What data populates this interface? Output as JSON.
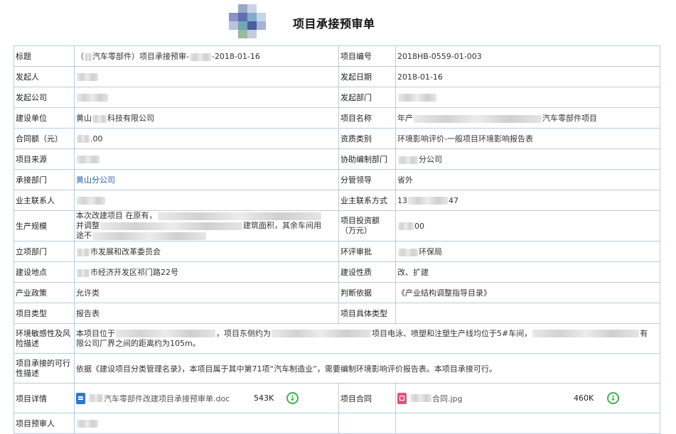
{
  "header": {
    "title": "项目承接预审单"
  },
  "fields": {
    "title_label": "标题",
    "title_prefix": "（",
    "title_middle": "汽车零部件）项目承接预审-",
    "title_suffix": "-2018-01-16",
    "project_no_label": "项目编号",
    "project_no": "2018HB-0559-01-003",
    "initiator_label": "发起人",
    "initiator_prefix": "",
    "init_date_label": "发起日期",
    "init_date": "2018-01-16",
    "init_company_label": "发起公司",
    "init_dept_label": "发起部门",
    "builder_label": "建设单位",
    "builder_prefix": "黄山",
    "builder_suffix": "科技有限公司",
    "project_name_label": "项目名称",
    "project_name_prefix": "年产",
    "project_name_suffix": "汽车零部件项目",
    "contract_amount_label": "合同额（元）",
    "contract_amount_suffix": ".00",
    "qualification_label": "资质类别",
    "qualification": "环境影响评价-一般项目环境影响报告表",
    "source_label": "项目来源",
    "assist_dept_label": "协助编制部门",
    "assist_dept_suffix": "分公司",
    "undertake_dept_label": "承接部门",
    "undertake_dept": "黄山分公司",
    "leader_label": "分管领导",
    "leader": "省外",
    "owner_contact_label": "业主联系人",
    "owner_phone_label": "业主联系方式",
    "owner_phone_prefix": "13",
    "owner_phone_suffix": "47",
    "scale_label": "生产规模",
    "scale_line1": "本次改建项目 在原有，",
    "scale_line2_prefix": "并调整",
    "scale_line2_suffix": "建筑面积，其余车间用",
    "scale_line3": "途不",
    "investment_label": "项目投资额（万元）",
    "investment_suffix": "00",
    "approval_dept_label": "立项部门",
    "approval_dept_suffix": "市发展和改革委员会",
    "eia_approval_label": "环评审批",
    "eia_approval_suffix": "环保局",
    "location_label": "建设地点",
    "location_suffix": "市经济开发区祁门路22号",
    "nature_label": "建设性质",
    "nature": "改、扩建",
    "policy_label": "产业政策",
    "policy": "允许类",
    "basis_label": "判断依据",
    "basis": "《产业结构调整指导目录》",
    "type_label": "项目类型",
    "type": "报告表",
    "specific_type_label": "项目具体类型",
    "specific_type": "",
    "sensitivity_label": "环境敏感性及风险描述",
    "sensitivity_line1_a": "本项目位于",
    "sensitivity_line1_b": "，项目东侧约为",
    "sensitivity_line1_c": "项目电泳、喷塑和注塑生产线均位于5#车间，",
    "sensitivity_line1_d": "有",
    "sensitivity_line2": "限公司厂界之间的距离约为105m。",
    "feasibility_label": "项目承接的可行性描述",
    "feasibility": "依据《建设项目分类管理名录》，本项目属于其中第71项“汽车制造业”，需要编制环境影响评价报告表。本项目承接可行。",
    "details_label": "项目详情",
    "details_file": "汽车零部件改建项目承接预审单.doc",
    "details_size": "543K",
    "contract_label": "项目合同",
    "contract_file": "合同.jpg",
    "contract_size": "460K",
    "reviewer_label": "项目预审人"
  },
  "colors": {
    "border": "#b9cde0",
    "link": "#2a62a8",
    "download": "#3db34a"
  },
  "icons": {
    "logo": "pixelated-logo",
    "doc": "word-doc-icon",
    "image": "image-file-icon",
    "download": "download-circle-icon"
  }
}
